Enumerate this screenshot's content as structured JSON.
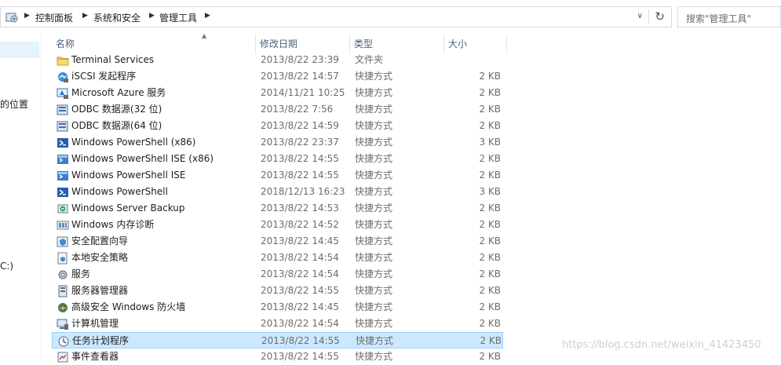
{
  "address": {
    "crumbs": [
      "控制面板",
      "系统和安全",
      "管理工具"
    ],
    "search_placeholder": "搜索\"管理工具\""
  },
  "nav": {
    "item_location": "的位置",
    "item_drive": "C:)"
  },
  "columns": {
    "name": "名称",
    "date": "修改日期",
    "type": "类型",
    "size": "大小"
  },
  "rows": [
    {
      "name": "Terminal Services",
      "date": "2013/8/22 23:39",
      "type": "文件夹",
      "size": "",
      "icon": "folder-icon"
    },
    {
      "name": "iSCSI 发起程序",
      "date": "2013/8/22 14:57",
      "type": "快捷方式",
      "size": "2 KB",
      "icon": "iscsi-icon"
    },
    {
      "name": "Microsoft Azure 服务",
      "date": "2014/11/21 10:25",
      "type": "快捷方式",
      "size": "2 KB",
      "icon": "azure-icon"
    },
    {
      "name": "ODBC 数据源(32 位)",
      "date": "2013/8/22 7:56",
      "type": "快捷方式",
      "size": "2 KB",
      "icon": "odbc-icon"
    },
    {
      "name": "ODBC 数据源(64 位)",
      "date": "2013/8/22 14:59",
      "type": "快捷方式",
      "size": "2 KB",
      "icon": "odbc-icon"
    },
    {
      "name": "Windows PowerShell (x86)",
      "date": "2013/8/22 23:37",
      "type": "快捷方式",
      "size": "3 KB",
      "icon": "powershell-icon"
    },
    {
      "name": "Windows PowerShell ISE (x86)",
      "date": "2013/8/22 14:55",
      "type": "快捷方式",
      "size": "2 KB",
      "icon": "powershell-ise-icon"
    },
    {
      "name": "Windows PowerShell ISE",
      "date": "2013/8/22 14:55",
      "type": "快捷方式",
      "size": "2 KB",
      "icon": "powershell-ise-icon"
    },
    {
      "name": "Windows PowerShell",
      "date": "2018/12/13 16:23",
      "type": "快捷方式",
      "size": "3 KB",
      "icon": "powershell-icon"
    },
    {
      "name": "Windows Server Backup",
      "date": "2013/8/22 14:53",
      "type": "快捷方式",
      "size": "2 KB",
      "icon": "backup-icon"
    },
    {
      "name": "Windows 内存诊断",
      "date": "2013/8/22 14:52",
      "type": "快捷方式",
      "size": "2 KB",
      "icon": "memory-diagnostic-icon"
    },
    {
      "name": "安全配置向导",
      "date": "2013/8/22 14:45",
      "type": "快捷方式",
      "size": "2 KB",
      "icon": "security-wizard-icon"
    },
    {
      "name": "本地安全策略",
      "date": "2013/8/22 14:54",
      "type": "快捷方式",
      "size": "2 KB",
      "icon": "security-policy-icon"
    },
    {
      "name": "服务",
      "date": "2013/8/22 14:54",
      "type": "快捷方式",
      "size": "2 KB",
      "icon": "services-icon"
    },
    {
      "name": "服务器管理器",
      "date": "2013/8/22 14:55",
      "type": "快捷方式",
      "size": "2 KB",
      "icon": "server-manager-icon"
    },
    {
      "name": "高级安全 Windows 防火墙",
      "date": "2013/8/22 14:45",
      "type": "快捷方式",
      "size": "2 KB",
      "icon": "firewall-icon"
    },
    {
      "name": "计算机管理",
      "date": "2013/8/22 14:54",
      "type": "快捷方式",
      "size": "2 KB",
      "icon": "computer-management-icon"
    },
    {
      "name": "任务计划程序",
      "date": "2013/8/22 14:55",
      "type": "快捷方式",
      "size": "2 KB",
      "icon": "task-scheduler-icon",
      "selected": true
    },
    {
      "name": "事件查看器",
      "date": "2013/8/22 14:55",
      "type": "快捷方式",
      "size": "2 KB",
      "icon": "event-viewer-icon"
    }
  ],
  "watermark": "https://blog.csdn.net/weixin_41423450"
}
